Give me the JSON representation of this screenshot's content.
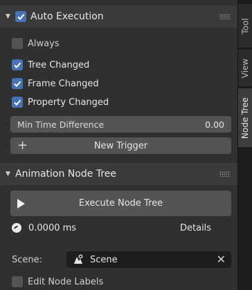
{
  "auto_execution": {
    "title": "Auto Execution",
    "enabled": true,
    "triggers": [
      {
        "label": "Always",
        "checked": false
      },
      {
        "label": "Tree Changed",
        "checked": true
      },
      {
        "label": "Frame Changed",
        "checked": true
      },
      {
        "label": "Property Changed",
        "checked": true
      }
    ],
    "min_time": {
      "label": "Min Time Difference",
      "value": "0.00"
    },
    "new_trigger_label": "New Trigger"
  },
  "animation_node_tree": {
    "title": "Animation Node Tree",
    "execute_label": "Execute Node Tree",
    "execution_time": "0.0000 ms",
    "details_label": "Details",
    "scene_label": "Scene:",
    "scene_value": "Scene",
    "edit_node_labels": {
      "label": "Edit Node Labels",
      "checked": false
    }
  },
  "sidebar_tabs": [
    "Tool",
    "View",
    "Node Tree"
  ],
  "active_tab": "Node Tree",
  "colors": {
    "accent": "#4772b3",
    "panel_bg": "#303030",
    "header_bg": "#3a3a3a",
    "widget_bg": "#545454"
  }
}
